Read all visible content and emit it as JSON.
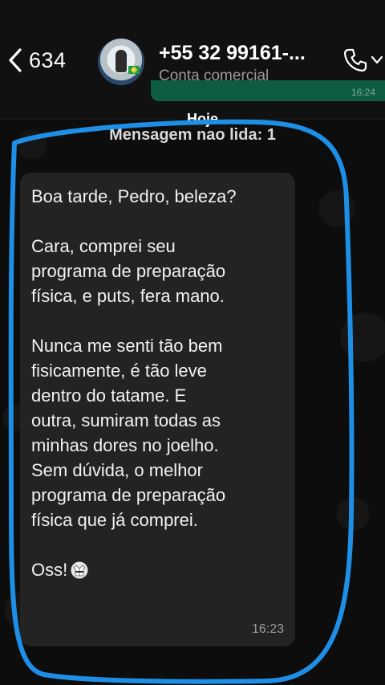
{
  "header": {
    "back_count": "634",
    "contact_name": "+55 32 99161-...",
    "contact_subtitle": "Conta comercial",
    "previous_message_time": "16:24",
    "icons": {
      "back": "chevron-left-icon",
      "call": "phone-icon",
      "call_menu": "chevron-down-icon"
    }
  },
  "chat": {
    "date_label": "Hoje",
    "unread_label": "Mensagem não lida: 1",
    "message": {
      "lines": [
        "Boa tarde, Pedro, beleza?",
        "",
        "Cara, comprei seu",
        "programa de preparação",
        "física, e puts, fera mano.",
        "",
        "Nunca me senti tão bem",
        "fisicamente, é tão leve",
        "dentro do tatame. E",
        "outra, sumiram todas as",
        "minhas dores no joelho.",
        "Sem dúvida, o melhor",
        "programa de preparação",
        "física que já comprei.",
        ""
      ],
      "closing": "Oss!",
      "closing_emoji": "martial-arts-uniform-icon",
      "time": "16:23"
    }
  },
  "colors": {
    "background": "#0d0d0d",
    "header": "#111111",
    "bubble": "#232323",
    "outgoing_bubble": "#0f5c44",
    "annotation_stroke": "#1e8fe6"
  }
}
